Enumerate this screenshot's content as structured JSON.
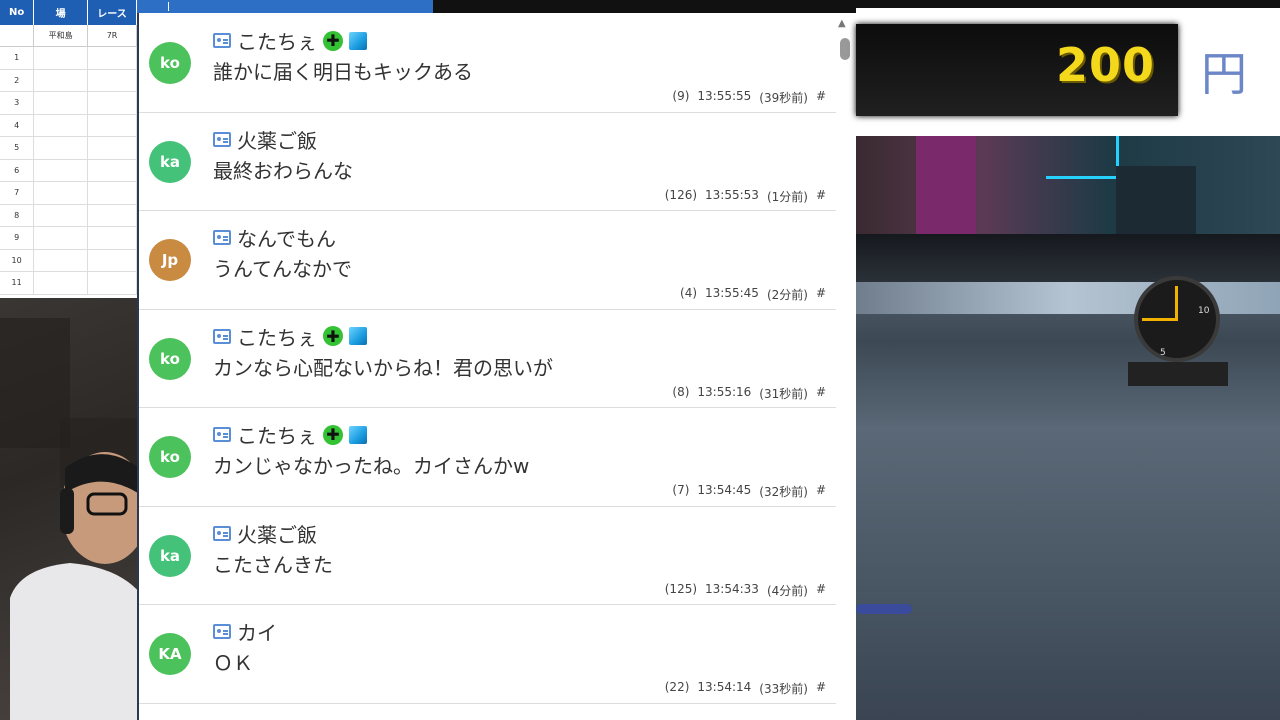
{
  "sheet": {
    "headers": [
      "No",
      "場",
      "レース"
    ],
    "sub": [
      "",
      "平和島",
      "7R"
    ],
    "rows": [
      "1",
      "2",
      "3",
      "4",
      "5",
      "6",
      "7",
      "8",
      "9",
      "10",
      "11"
    ]
  },
  "price": {
    "amount": "200",
    "unit": "円"
  },
  "chat": {
    "messages": [
      {
        "initials": "ko",
        "avatar_color": "#4cc25c",
        "name": "こたちぇ",
        "badges": true,
        "text": "誰かに届く明日もキックある",
        "num": "(9)",
        "time": "13:55:55",
        "ago": "(39秒前)",
        "hash": "#"
      },
      {
        "initials": "ka",
        "avatar_color": "#45c27a",
        "name": "火薬ご飯",
        "badges": false,
        "text": "最終おわらんな",
        "num": "(126)",
        "time": "13:55:53",
        "ago": "(1分前)",
        "hash": "#"
      },
      {
        "initials": "Jp",
        "avatar_color": "#c98a42",
        "name": "なんでもん",
        "badges": false,
        "text": "うんてんなかで",
        "num": "(4)",
        "time": "13:55:45",
        "ago": "(2分前)",
        "hash": "#"
      },
      {
        "initials": "ko",
        "avatar_color": "#4cc25c",
        "name": "こたちぇ",
        "badges": true,
        "text": "カンなら心配ないからね！君の思いが",
        "num": "(8)",
        "time": "13:55:16",
        "ago": "(31秒前)",
        "hash": "#"
      },
      {
        "initials": "ko",
        "avatar_color": "#4cc25c",
        "name": "こたちぇ",
        "badges": true,
        "text": "カンじゃなかったね。カイさんかw",
        "num": "(7)",
        "time": "13:54:45",
        "ago": "(32秒前)",
        "hash": "#"
      },
      {
        "initials": "ka",
        "avatar_color": "#45c27a",
        "name": "火薬ご飯",
        "badges": false,
        "text": "こたさんきた",
        "num": "(125)",
        "time": "13:54:33",
        "ago": "(4分前)",
        "hash": "#"
      },
      {
        "initials": "KA",
        "avatar_color": "#4cc25c",
        "name": "カイ",
        "badges": false,
        "text": "ＯＫ",
        "num": "(22)",
        "time": "13:54:14",
        "ago": "(33秒前)",
        "hash": "#"
      }
    ]
  },
  "clock": {
    "n10": "10",
    "n5": "5"
  }
}
